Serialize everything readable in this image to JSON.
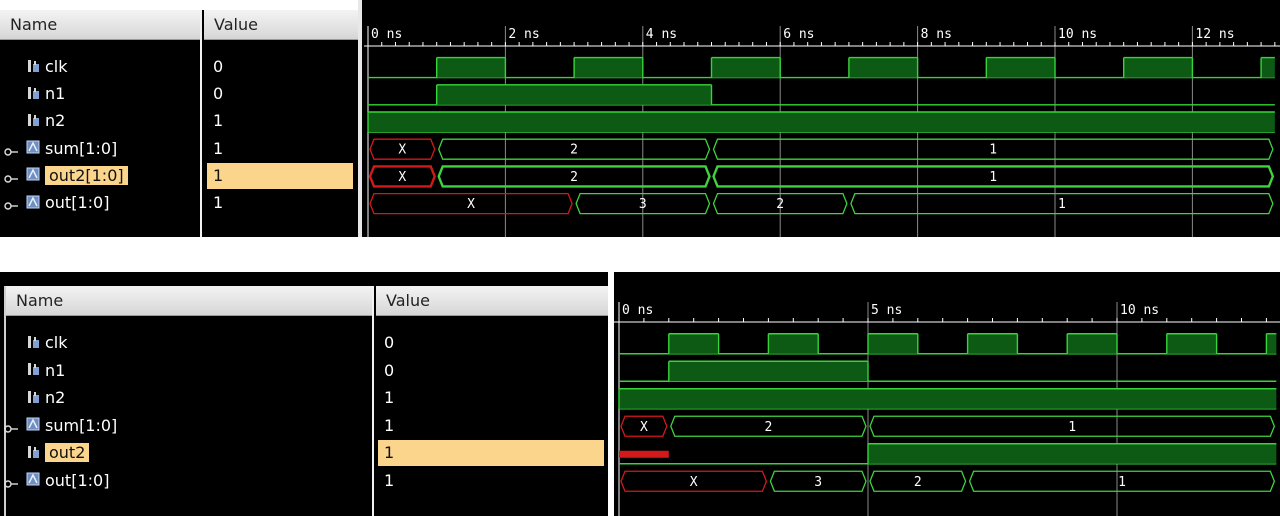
{
  "colors": {
    "wave_green": "#0d5a14",
    "wave_edge": "#36d43a",
    "bus_green": "#3fd33f",
    "bus_red": "#d21a1a",
    "grid": "#8a8a8a",
    "selected_bg": "#fcd58c"
  },
  "top": {
    "headers": {
      "name": "Name",
      "value": "Value"
    },
    "signals": [
      {
        "id": "clk",
        "name": "clk",
        "value": "0",
        "kind": "bit",
        "selected": false
      },
      {
        "id": "n1",
        "name": "n1",
        "value": "0",
        "kind": "bit",
        "selected": false
      },
      {
        "id": "n2",
        "name": "n2",
        "value": "1",
        "kind": "bit",
        "selected": false
      },
      {
        "id": "sum",
        "name": "sum[1:0]",
        "value": "1",
        "kind": "bus",
        "selected": false
      },
      {
        "id": "out2",
        "name": "out2[1:0]",
        "value": "1",
        "kind": "bus",
        "selected": true
      },
      {
        "id": "out",
        "name": "out[1:0]",
        "value": "1",
        "kind": "bus",
        "selected": false
      }
    ],
    "time_labels": [
      "0 ns",
      "2 ns",
      "4 ns",
      "6 ns",
      "8 ns",
      "10 ns",
      "12 ns"
    ],
    "waves": {
      "clk": {
        "high": [
          [
            1,
            2
          ],
          [
            3,
            4
          ],
          [
            5,
            6
          ],
          [
            7,
            8
          ],
          [
            9,
            10
          ],
          [
            11,
            12
          ],
          [
            13,
            13.2
          ]
        ]
      },
      "n1": {
        "high": [
          [
            1,
            5
          ]
        ]
      },
      "n2": {
        "high": [
          [
            0,
            13.2
          ]
        ]
      },
      "sum": {
        "segs": [
          {
            "from": 0,
            "to": 1,
            "label": "X",
            "red": true
          },
          {
            "from": 1,
            "to": 5,
            "label": "2"
          },
          {
            "from": 5,
            "to": 13.2,
            "label": "1"
          }
        ]
      },
      "out2": {
        "segs": [
          {
            "from": 0,
            "to": 1,
            "label": "X",
            "red": true
          },
          {
            "from": 1,
            "to": 5,
            "label": "2"
          },
          {
            "from": 5,
            "to": 13.2,
            "label": "1"
          }
        ]
      },
      "out": {
        "segs": [
          {
            "from": 0,
            "to": 3,
            "label": "X",
            "red": true
          },
          {
            "from": 3,
            "to": 5,
            "label": "3"
          },
          {
            "from": 5,
            "to": 7,
            "label": "2"
          },
          {
            "from": 7,
            "to": 13.2,
            "label": "1"
          }
        ]
      }
    }
  },
  "bottom": {
    "headers": {
      "name": "Name",
      "value": "Value"
    },
    "signals": [
      {
        "id": "clk",
        "name": "clk",
        "value": "0",
        "kind": "bit",
        "selected": false
      },
      {
        "id": "n1",
        "name": "n1",
        "value": "0",
        "kind": "bit",
        "selected": false
      },
      {
        "id": "n2",
        "name": "n2",
        "value": "1",
        "kind": "bit",
        "selected": false
      },
      {
        "id": "sum",
        "name": "sum[1:0]",
        "value": "1",
        "kind": "bus",
        "selected": false
      },
      {
        "id": "out2",
        "name": "out2",
        "value": "1",
        "kind": "bit",
        "selected": true
      },
      {
        "id": "out",
        "name": "out[1:0]",
        "value": "1",
        "kind": "bus",
        "selected": false
      }
    ],
    "time_labels": [
      "0 ns",
      "5 ns",
      "10 ns"
    ],
    "waves": {
      "clk": {
        "high": [
          [
            1,
            2
          ],
          [
            3,
            4
          ],
          [
            5,
            6
          ],
          [
            7,
            8
          ],
          [
            9,
            10
          ],
          [
            11,
            12
          ],
          [
            13,
            13.2
          ]
        ]
      },
      "n1": {
        "high": [
          [
            1,
            5
          ]
        ]
      },
      "n2": {
        "high": [
          [
            0,
            13.2
          ]
        ]
      },
      "sum": {
        "segs": [
          {
            "from": 0,
            "to": 1,
            "label": "X",
            "red": true
          },
          {
            "from": 1,
            "to": 5,
            "label": "2"
          },
          {
            "from": 5,
            "to": 13.2,
            "label": "1"
          }
        ]
      },
      "out2": {
        "xspan": [
          0,
          1
        ],
        "low": [
          [
            1,
            5
          ]
        ],
        "high": [
          [
            5,
            13.2
          ]
        ]
      },
      "out": {
        "segs": [
          {
            "from": 0,
            "to": 3,
            "label": "X",
            "red": true
          },
          {
            "from": 3,
            "to": 5,
            "label": "3"
          },
          {
            "from": 5,
            "to": 7,
            "label": "2"
          },
          {
            "from": 7,
            "to": 13.2,
            "label": "1"
          }
        ]
      }
    }
  }
}
